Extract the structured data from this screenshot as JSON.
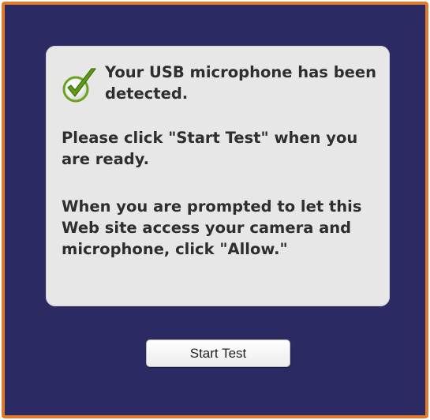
{
  "dialog": {
    "detected_message": "Your USB microphone has been detected.",
    "detected_icon": "checkmark-icon",
    "instruction_start": "Please click \"Start Test\" when you are ready.",
    "instruction_allow": "When you are prompted to let this Web site access your camera and microphone, click \"Allow.\"",
    "start_button_label": "Start Test"
  },
  "colors": {
    "frame_border": "#e27a2c",
    "background": "#2b2a63",
    "panel": "#e7e7e7",
    "check_green": "#6aa41a"
  }
}
